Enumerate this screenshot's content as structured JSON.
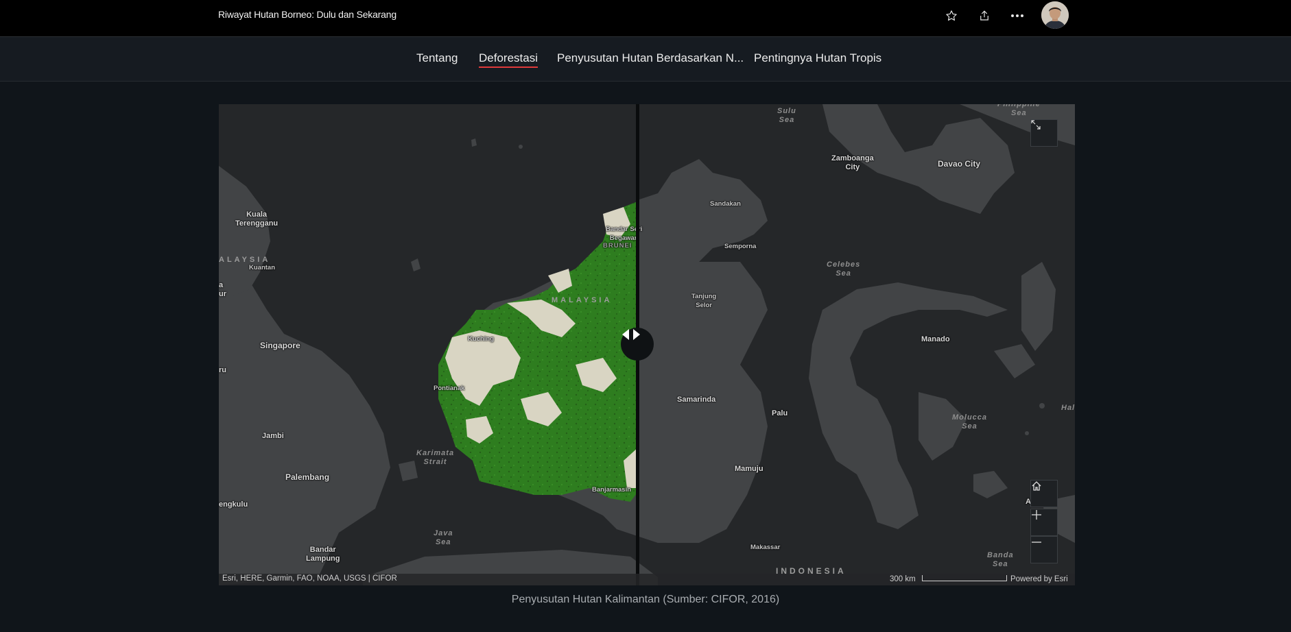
{
  "header": {
    "title": "Riwayat Hutan Borneo: Dulu dan Sekarang",
    "icons": [
      "star-icon",
      "share-icon",
      "more-icon"
    ]
  },
  "nav": {
    "tabs": [
      {
        "label": "Tentang",
        "active": false
      },
      {
        "label": "Deforestasi",
        "active": true
      },
      {
        "label": "Penyusutan Hutan Berdasarkan N...",
        "active": false
      },
      {
        "label": "Pentingnya Hutan Tropis",
        "active": false
      }
    ],
    "accent_color": "#e03a3a"
  },
  "map": {
    "labels": {
      "kuala_terengganu": "Kuala\nTerengganu",
      "malaysia_left": "ALAYSIA",
      "kuantan": "Kuantan",
      "edge_a": "a\nur",
      "singapore": "Singapore",
      "edge_ru": "ru",
      "jambi": "Jambi",
      "palembang": "Palembang",
      "bengkulu": "engkulu",
      "bandar_lampung": "Bandar\nLampung",
      "karimata": "Karimata\nStrait",
      "java_sea": "Java\nSea",
      "kuching": "Kuching",
      "pontianak": "Pontianak",
      "malaysia_borneo": "MALAYSIA",
      "bandar_seri": "Bandar Seri\nBegawan",
      "brunei": "BRUNEI",
      "banjarmasin": "Banjarmasin",
      "sulu_sea": "Sulu\nSea",
      "philippine_sea": "Philippine\nSea",
      "zamboanga": "Zamboanga\nCity",
      "davao": "Davao City",
      "sandakan": "Sandakan",
      "semporna": "Semporna",
      "celebes_sea": "Celebes\nSea",
      "tanjung_selor": "Tanjung\nSelor",
      "manado": "Manado",
      "samarinda": "Samarinda",
      "palu": "Palu",
      "molucca_sea": "Molucca\nSea",
      "hal": "Hal",
      "mamuju": "Mamuju",
      "makassar": "Makassar",
      "indonesia": "INDONESIA",
      "banda_sea": "Banda\nSea",
      "edge_a2": "A"
    },
    "forest_color": "#2e7d1f",
    "cleared_color": "#d9d5c3",
    "attribution": "Esri, HERE, Garmin, FAO, NOAA, USGS | CIFOR",
    "scale_label": "300 km",
    "powered_by": "Powered by Esri",
    "controls": [
      "expand-icon",
      "home-icon",
      "plus-icon",
      "minus-icon"
    ]
  },
  "caption": "Penyusutan Hutan Kalimantan (Sumber: CIFOR, 2016)"
}
